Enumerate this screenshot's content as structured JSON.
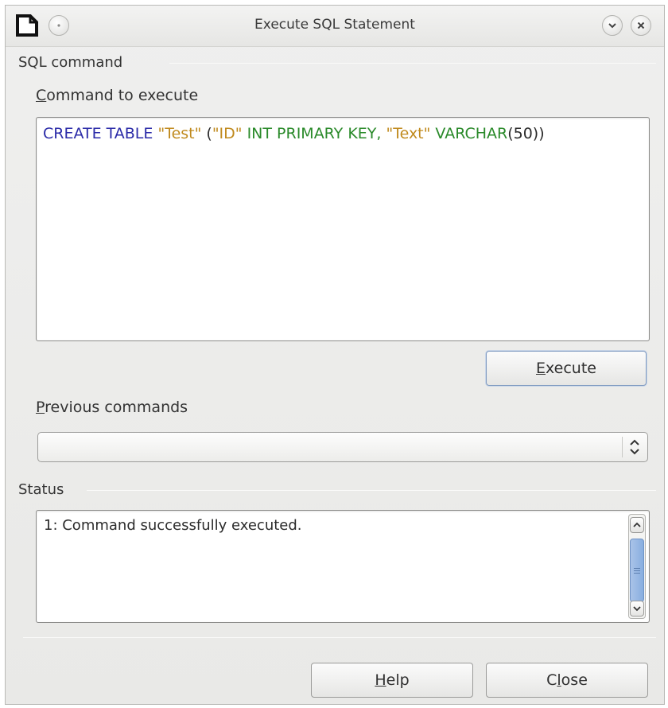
{
  "window": {
    "title": "Execute SQL Statement"
  },
  "icons": {
    "app": "document-icon",
    "menu": "menu-icon",
    "minimize": "chevron-down-icon",
    "close": "close-icon"
  },
  "sql_section": {
    "heading": "SQL command",
    "command_label_mnemonic": "C",
    "command_label_rest": "ommand to execute",
    "command_tokens": [
      {
        "text": "CREATE TABLE ",
        "color": "#2b2ba8"
      },
      {
        "text": "\"Test\"",
        "color": "#c08a1e"
      },
      {
        "text": " (",
        "color": "#2b2b2b"
      },
      {
        "text": "\"ID\"",
        "color": "#c08a1e"
      },
      {
        "text": " INT PRIMARY KEY, ",
        "color": "#2a8a2a"
      },
      {
        "text": "\"Text\"",
        "color": "#c08a1e"
      },
      {
        "text": " VARCHAR",
        "color": "#2a8a2a"
      },
      {
        "text": "(50))",
        "color": "#2b2b2b"
      }
    ],
    "execute_mnemonic": "E",
    "execute_rest": "xecute",
    "previous_label_mnemonic": "P",
    "previous_label_rest": "revious commands",
    "previous_selected": ""
  },
  "status_section": {
    "heading": "Status",
    "message": "1: Command successfully executed."
  },
  "footer": {
    "help_mnemonic": "H",
    "help_rest": "elp",
    "close_pre": "C",
    "close_mnemonic": "l",
    "close_rest": "ose"
  },
  "colors": {
    "keyword": "#2b2ba8",
    "identifier": "#c08a1e",
    "type": "#2a8a2a",
    "scroll_thumb": "#88aee0"
  }
}
